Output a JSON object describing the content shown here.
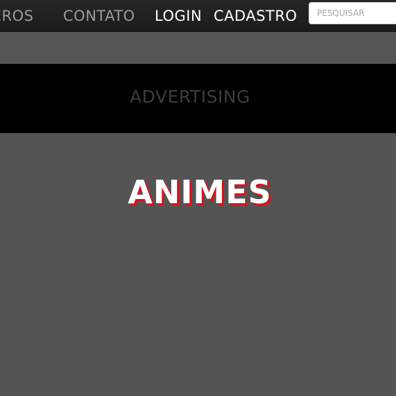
{
  "nav": {
    "items": [
      {
        "label": "Gêneros"
      },
      {
        "label": "Contato"
      },
      {
        "label": "Login"
      },
      {
        "label": "Cadastro"
      }
    ],
    "search": {
      "placeholder": "PESQUISAR",
      "value": ""
    }
  },
  "ad": {
    "label": "ADVERTISING"
  },
  "main": {
    "title": "ANIMES"
  },
  "colors": {
    "nav_bg": "#222222",
    "nav_dim_text": "#9b9b9b",
    "nav_bright_text": "#ffffff",
    "ad_bg": "#000000",
    "ad_text": "#3c3c3c",
    "page_bg": "#545454",
    "title_shadow": "#d8121a"
  }
}
